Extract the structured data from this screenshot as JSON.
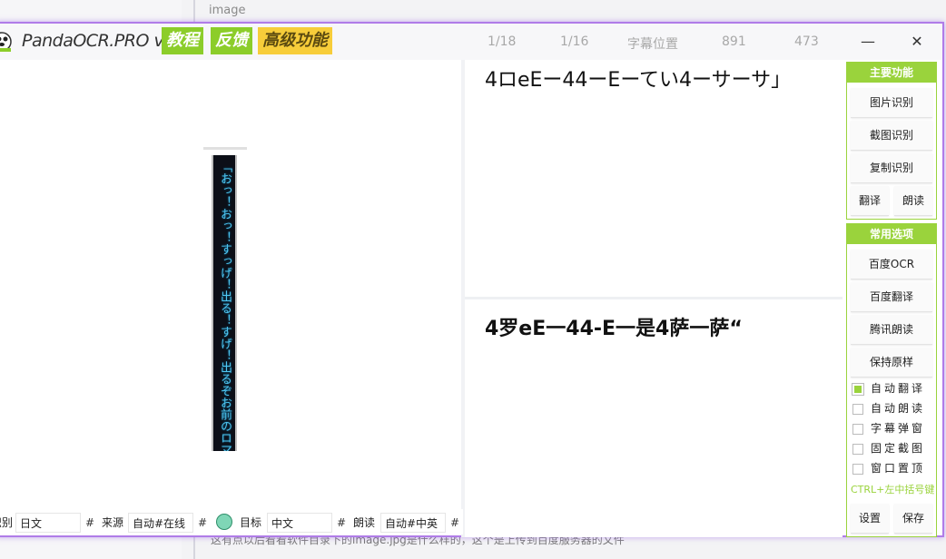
{
  "background": {
    "top_text": "image",
    "bottom_text": "这有点以后看看软件目录下的image.jpg是什么样的，这个是上传到百度服务器的文件"
  },
  "titlebar": {
    "app_name": "PandaOCR.PRO v5.47",
    "btn_tutorial": "教程",
    "btn_feedback": "反馈",
    "btn_advanced": "高级功能",
    "info": [
      "1/18",
      "1/16",
      "字幕位置",
      "891",
      "473"
    ],
    "minimize": "—",
    "close": "✕"
  },
  "preview": {
    "strip_text": "「おっ！おっ！すっげ！出る！すげ！出るぞお前のロマ〇"
  },
  "bottombar": {
    "recognize_label": "识别",
    "recognize_value": "日文",
    "hash1": "#",
    "source_label": "来源",
    "source_value": "自动#在线",
    "hash2": "#",
    "target_label": "目标",
    "target_value": "中文",
    "hash3": "#",
    "read_label": "朗读",
    "read_value": "自动#中英",
    "hash4": "#"
  },
  "results": {
    "ocr_text": "4ロeEー44ーEーてい4ーサーサ」",
    "translation_text": "4罗eE一44-E一是4萨一萨“"
  },
  "sidebar": {
    "main_title": "主要功能",
    "btn_image": "图片识别",
    "btn_screenshot": "截图识别",
    "btn_copy": "复制识别",
    "btn_translate": "翻译",
    "btn_read": "朗读",
    "options_title": "常用选项",
    "btn_baidu_ocr": "百度OCR",
    "btn_baidu_translate": "百度翻译",
    "btn_tencent_read": "腾讯朗读",
    "btn_keep_original": "保持原样",
    "chk_auto_translate": "自动翻译",
    "chk_auto_read": "自动朗读",
    "chk_subtitle_popup": "字幕弹窗",
    "chk_fixed_capture": "固定截图",
    "chk_window_top": "窗口置顶",
    "hotkey_text": "CTRL+左中括号键",
    "btn_settings": "设置",
    "btn_save": "保存"
  },
  "colors": {
    "accent_green": "#9ad33c",
    "accent_yellow": "#f7cd3a",
    "window_border": "#b07ce8"
  }
}
